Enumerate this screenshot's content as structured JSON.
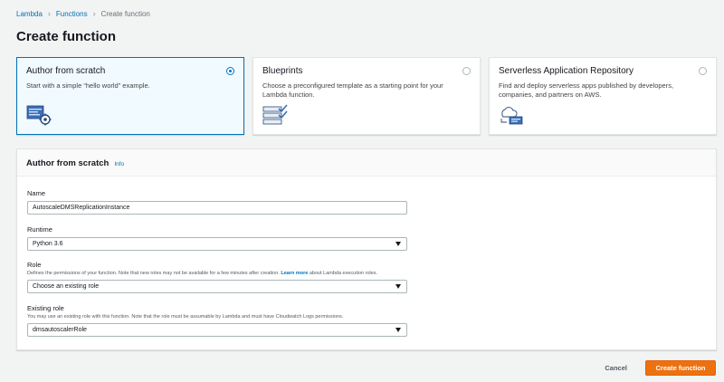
{
  "breadcrumb": {
    "items": [
      "Lambda",
      "Functions"
    ],
    "current": "Create function"
  },
  "page": {
    "title": "Create function"
  },
  "options": [
    {
      "title": "Author from scratch",
      "desc": "Start with a simple “hello world” example.",
      "selected": true,
      "icon": "code-gear-icon"
    },
    {
      "title": "Blueprints",
      "desc": "Choose a preconfigured template as a starting point for your Lambda function.",
      "selected": false,
      "icon": "blueprint-checklist-icon"
    },
    {
      "title": "Serverless Application Repository",
      "desc": "Find and deploy serverless apps published by developers, companies, and partners on AWS.",
      "selected": false,
      "icon": "cloud-repository-icon"
    }
  ],
  "form": {
    "header": "Author from scratch",
    "info_link": "Info",
    "name": {
      "label": "Name",
      "value": "AutoscaleDMSReplicationInstance"
    },
    "runtime": {
      "label": "Runtime",
      "value": "Python 3.6"
    },
    "role": {
      "label": "Role",
      "help_before": "Defines the permissions of your function. Note that new roles may not be available for a few minutes after creation.",
      "help_link": "Learn more",
      "help_after": "about Lambda execution roles.",
      "value": "Choose an existing role"
    },
    "existing_role": {
      "label": "Existing role",
      "help": "You may use an existing role with this function. Note that the role must be assumable by Lambda and must have Cloudwatch Logs permissions.",
      "value": "dmsautoscalerRole"
    }
  },
  "actions": {
    "cancel": "Cancel",
    "create": "Create function"
  },
  "colors": {
    "accent": "#0073bb",
    "primary_button": "#ec7211",
    "background": "#f2f3f3"
  }
}
